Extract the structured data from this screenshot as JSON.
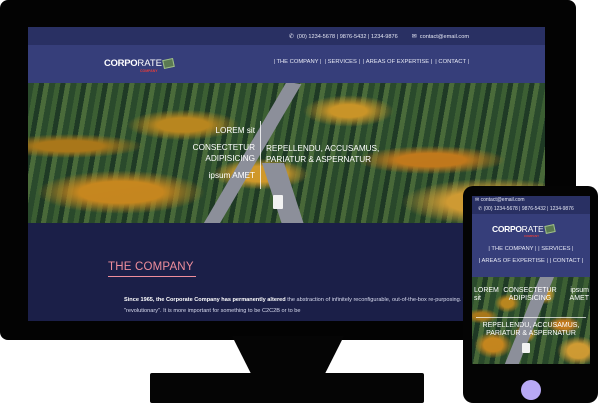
{
  "contact": {
    "phone": "(00) 1234-5678 | 9876-5432 | 1234-9876",
    "email": "contact@email.com"
  },
  "brand": {
    "name_bold": "CORPO",
    "name_light": "RATE",
    "tagline": "COMPANY"
  },
  "nav": {
    "items": [
      "| THE COMPANY |",
      "| SERVICES |",
      "| AREAS OF EXPERTISE |",
      "| CONTACT |"
    ]
  },
  "hero": {
    "left_line1": "LOREM sit",
    "left_line2": "CONSECTETUR",
    "left_line3": "ADIPISICING",
    "left_line4": "ipsum AMET",
    "right_line1": "REPELLENDU, ACCUSAMUS,",
    "right_line2": "PARIATUR & ASPERNATUR"
  },
  "section": {
    "heading": "THE COMPANY",
    "para_bold": "Since 1965, the Corporate Company has permanently altered",
    "para_rest": " the abstraction of infinitely reconfigurable, out-of-the-box re-purposing. We will innovate the industry jargon \"revolutionary\". It is more important for something to be C2C2B or to be"
  },
  "phone": {
    "menu_row1": "| THE COMPANY |   | SERVICES |",
    "menu_row2": "| AREAS OF EXPERTISE |   | CONTACT |",
    "hero_t1": "LOREM sit",
    "hero_t2": "CONSECTETUR ADIPISICING",
    "hero_t3": "ipsum AMET",
    "hero_t4": "REPELLENDU, ACCUSAMUS, PARIATUR & ASPERNATUR"
  },
  "colors": {
    "topbar": "#293063",
    "nav": "#363e7a",
    "body": "#1b1f48",
    "heading_accent": "#ef8e9c",
    "logo_red": "#e23d3d"
  },
  "icons": [
    "phone-icon",
    "email-icon",
    "logo-mark-icon"
  ]
}
